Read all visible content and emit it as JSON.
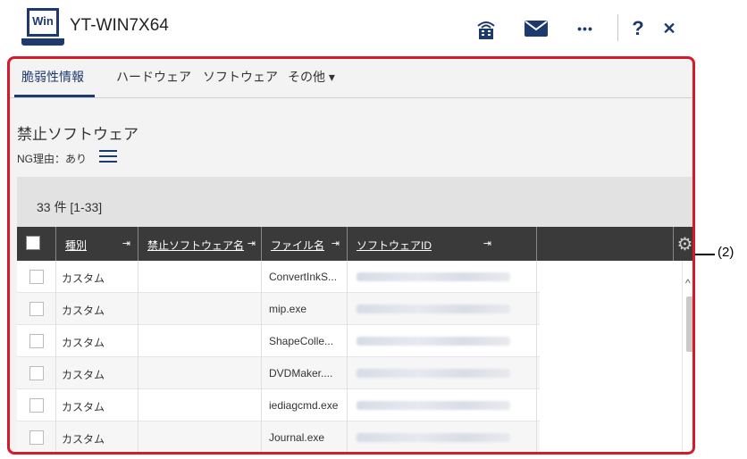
{
  "window": {
    "logo_text": "Win",
    "title": "YT-WIN7X64",
    "accent": "#1d3a6e",
    "frame_color": "#d61a2a",
    "icons": [
      "building-icon",
      "mail-icon",
      "more-icon",
      "help-icon",
      "close-icon"
    ],
    "help_glyph": "?",
    "close_glyph": "✕",
    "more_glyph": "•••"
  },
  "tabs": [
    {
      "label": "脆弱性情報",
      "active": true
    },
    {
      "label": "ハードウェア",
      "active": false
    },
    {
      "label": "ソフトウェア",
      "active": false
    },
    {
      "label": "その他 ▾",
      "active": false
    }
  ],
  "section": {
    "title": "禁止ソフトウェア",
    "ng_reason": "NG理由：あり"
  },
  "count": "33 件  [1-33]",
  "columns": {
    "type": "種別",
    "name": "禁止ソフトウェア名",
    "file": "ファイル名",
    "id": "ソフトウェアID",
    "pin": "⇥"
  },
  "rows": [
    {
      "type": "カスタム",
      "name": "",
      "file": "ConvertInkS..."
    },
    {
      "type": "カスタム",
      "name": "",
      "file": "mip.exe"
    },
    {
      "type": "カスタム",
      "name": "",
      "file": "ShapeColle..."
    },
    {
      "type": "カスタム",
      "name": "",
      "file": "DVDMaker...."
    },
    {
      "type": "カスタム",
      "name": "",
      "file": "iediagcmd.exe"
    },
    {
      "type": "カスタム",
      "name": "",
      "file": "Journal.exe"
    }
  ],
  "callout": "(2)"
}
